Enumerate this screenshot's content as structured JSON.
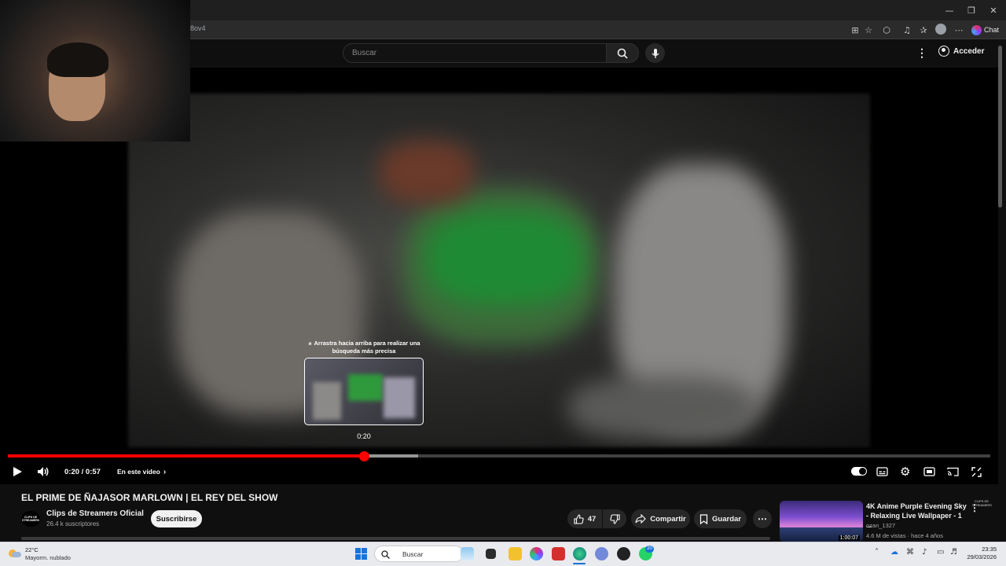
{
  "browser": {
    "url_fragment": "8ov4",
    "chat_label": "Chat",
    "window_controls": [
      "—",
      "❐",
      "✕"
    ]
  },
  "youtube": {
    "search_placeholder": "Buscar",
    "signin_label": "Acceder"
  },
  "player": {
    "seek_hint": "⌅ Arrastra hacia arriba para realizar una búsqueda más precisa",
    "preview_time": "0:20",
    "time_display": "0:20 / 0:57",
    "chapter_label": "En este video",
    "watermark": "CLIPS DE STREAMERS",
    "progress_fraction": 0.36,
    "buffered_fraction": 0.417
  },
  "video": {
    "title": "EL PRIME DE ÑAJASOR MARLOWN | EL REY DEL SHOW",
    "channel": {
      "name": "Clips de Streamers Oficial",
      "subscribers": "26.4 k suscriptores",
      "avatar_text": "CLIPS DE STREAMERS"
    },
    "subscribe_label": "Suscribirse",
    "likes": "47",
    "share_label": "Compartir",
    "save_label": "Guardar"
  },
  "recommendation": {
    "title": "4K Anime Purple Evening Sky - Relaxing Live Wallpaper - 1 ...",
    "channel": "ozan_1327",
    "meta": "4.6 M de vistas · hace 4 años",
    "duration": "1:00:07"
  },
  "taskbar": {
    "weather_temp": "22°C",
    "weather_desc": "Mayorm. nublado",
    "search_placeholder": "Buscar",
    "time": "23:35",
    "date": "29/03/2026",
    "badge_count": "20"
  },
  "colors": {
    "accent_red": "#ff0000",
    "background": "#0f0f0f",
    "taskbar": "#e9eaee"
  }
}
